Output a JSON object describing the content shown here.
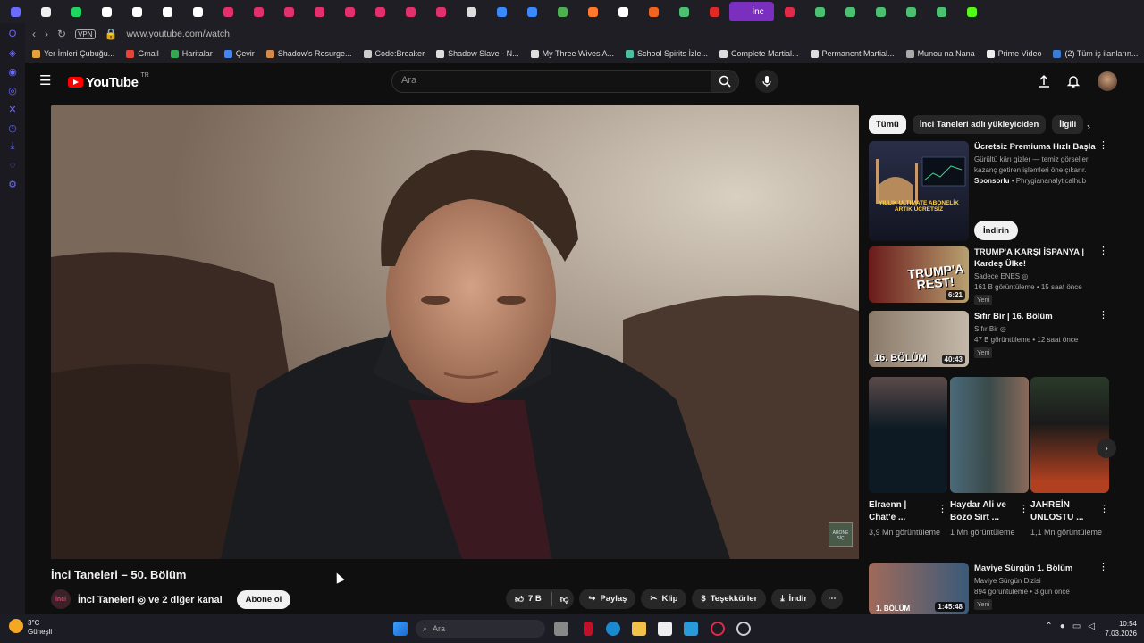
{
  "browser": {
    "tabs": [
      "opera",
      "gmail",
      "spotify",
      "maps",
      "maps2",
      "maps3",
      "maps4",
      "instagram",
      "instagram2",
      "instagram3",
      "instagram4",
      "instagram5",
      "instagram6",
      "instagram7",
      "instagram8",
      "x",
      "ext",
      "calendar",
      "chart",
      "ext2",
      "notion",
      "etsy",
      "check",
      "youtube",
      "youtube-active",
      "youtube2",
      "check2",
      "check3",
      "check4",
      "check5",
      "check6",
      "kick"
    ],
    "active_tab_label": "İnc",
    "url": "www.youtube.com/watch",
    "vpn_label": "VPN",
    "bookmarks": [
      {
        "label": "Yer İmleri Çubuğu...",
        "color": "#e4a23b"
      },
      {
        "label": "Gmail",
        "color": "#ea4335"
      },
      {
        "label": "Haritalar",
        "color": "#34a853"
      },
      {
        "label": "Çevir",
        "color": "#4285f4"
      },
      {
        "label": "Shadow's Resurge...",
        "color": "#d68a4a"
      },
      {
        "label": "Code:Breaker",
        "color": "#ccc"
      },
      {
        "label": "Shadow Slave - N...",
        "color": "#ddd"
      },
      {
        "label": "My Three Wives A...",
        "color": "#ddd"
      },
      {
        "label": "School Spirits İzle...",
        "color": "#4ac0a0"
      },
      {
        "label": "Complete Martial...",
        "color": "#ddd"
      },
      {
        "label": "Permanent Martial...",
        "color": "#ddd"
      },
      {
        "label": "Munou na Nana",
        "color": "#aaa"
      },
      {
        "label": "Prime Video",
        "color": "#eee"
      },
      {
        "label": "(2) Tüm iş ilanların...",
        "color": "#3a7bd5"
      }
    ]
  },
  "youtube": {
    "logo_text": "YouTube",
    "logo_country": "TR",
    "search_placeholder": "Ara"
  },
  "video": {
    "title": "İnci Taneleri – 50. Bölüm",
    "channel": "İnci Taneleri ◎ ve 2 diğer kanal",
    "channel_avatar_text": "İnci",
    "subscribe_label": "Abone ol",
    "watermark": "ARONE SİÇ",
    "actions": {
      "like": "7 B",
      "share": "Paylaş",
      "clip": "Klip",
      "thanks": "Teşekkürler",
      "download": "İndir"
    }
  },
  "chips": [
    "Tümü",
    "İnci Taneleri adlı yükleyiciden",
    "İlgili"
  ],
  "recommendations": [
    {
      "title": "Ücretsiz Premiuma Hızlı Başla",
      "line1": "Gürültü kârı gizler — temiz görseller kazanç getiren işlemleri öne çıkarır.",
      "line2_bold": "Sponsorlu",
      "line2_rest": " • Phrygiananalyticalhub",
      "ad_button": "İndirin",
      "thumb_text": "YILLIK ULTIMATE ABONELİK ARTIK ÜCRETSİZ",
      "duration": "",
      "badge": ""
    },
    {
      "title": "TRUMP'A KARŞI İSPANYA | Kardeş Ülke!",
      "line1": "Sadece ENES ◎",
      "line2_rest": "161 B görüntüleme • 15 saat önce",
      "thumb_text": "TRUMP'A REST!",
      "duration": "6:21",
      "badge": "Yeni"
    },
    {
      "title": "Sıfır Bir | 16. Bölüm",
      "line1": "Sıfır Bir ◎",
      "line2_rest": "47 B görüntüleme • 12 saat önce",
      "thumb_text": "16. BÖLÜM",
      "duration": "40:43",
      "badge": "Yeni"
    },
    {
      "title": "Maviye Sürgün 1. Bölüm",
      "line1": "Maviye Sürgün Dizisi",
      "line2_rest": "894 görüntüleme • 3 gün önce",
      "thumb_text": "1. BÖLÜM",
      "duration": "1:45:48",
      "badge": "Yeni"
    }
  ],
  "shorts": [
    {
      "title": "Elraenn | Chat'e ...",
      "views": "3,9 Mn görüntüleme"
    },
    {
      "title": "Haydar Ali ve Bozo Sırt ...",
      "views": "1 Mn görüntüleme"
    },
    {
      "title": "JAHREİN UNLOSTU ...",
      "views": "1,1 Mn görüntüleme"
    }
  ],
  "taskbar": {
    "weather_temp": "3°C",
    "weather_desc": "Güneşli",
    "search_placeholder": "Ara",
    "time": "10:54",
    "date": "7.03.2026"
  }
}
